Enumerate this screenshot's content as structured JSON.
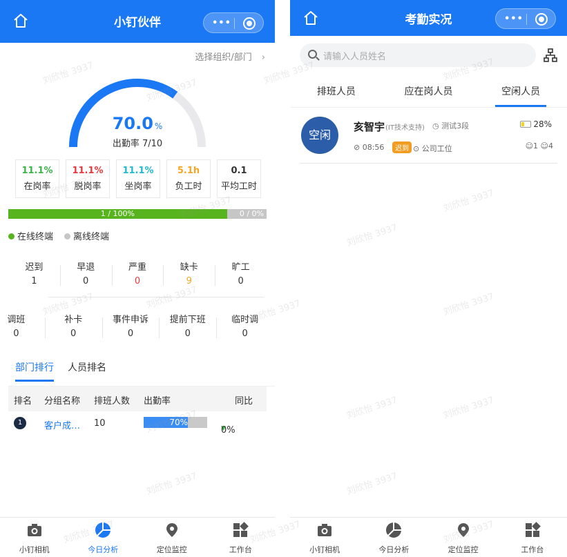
{
  "left": {
    "title": "小钉伙伴",
    "select_org": "选择组织/部门",
    "gauge": {
      "value": "70.0",
      "unit": "%",
      "label": "出勤率 7/10",
      "fraction": 0.7
    },
    "stats": [
      {
        "value": "11.1%",
        "label": "在岗率",
        "color": "#3bb54a"
      },
      {
        "value": "11.1%",
        "label": "脱岗率",
        "color": "#e8383d"
      },
      {
        "value": "11.1%",
        "label": "坐岗率",
        "color": "#1fbad1"
      },
      {
        "value": "5.1h",
        "label": "负工时",
        "color": "#f5a623"
      },
      {
        "value": "0.1",
        "label": "平均工时",
        "color": "#333333"
      }
    ],
    "terminal_bar": {
      "online_text": "1 / 100%",
      "offline_text": "0 / 0%",
      "online_fraction": 0.847
    },
    "legend": {
      "online": "在线终端",
      "offline": "离线终端"
    },
    "row1": [
      {
        "label": "迟到",
        "value": "1"
      },
      {
        "label": "早退",
        "value": "0"
      },
      {
        "label": "严重",
        "value": "0"
      },
      {
        "label": "缺卡",
        "value": "9"
      },
      {
        "label": "旷工",
        "value": "0"
      }
    ],
    "row2": [
      {
        "label": "调班",
        "value": "0"
      },
      {
        "label": "补卡",
        "value": "0"
      },
      {
        "label": "事件申诉",
        "value": "0"
      },
      {
        "label": "提前下班",
        "value": "0"
      },
      {
        "label": "临时调",
        "value": "0"
      }
    ],
    "tabs": {
      "dept_rank": "部门排行",
      "person_rank": "人员排名"
    },
    "table": {
      "headers": {
        "rank": "排名",
        "group": "分组名称",
        "scheduled": "排班人数",
        "attendance": "出勤率",
        "yoy": "同比"
      },
      "rows": [
        {
          "rank": "1",
          "group": "客户成…",
          "scheduled": "10",
          "attendance": "70%",
          "attendance_fraction": 0.7,
          "yoy": "0%"
        }
      ]
    }
  },
  "right": {
    "title": "考勤实况",
    "search_placeholder": "请输入人员姓名",
    "tabs": {
      "scheduled": "排班人员",
      "on_duty": "应在岗人员",
      "idle": "空闲人员"
    },
    "card": {
      "avatar": "空闲",
      "name": "亥智宇",
      "dept": "(IT技术支持)",
      "shift": "测试3段",
      "battery": "28%",
      "time": "08:56",
      "late_badge": "迟到",
      "location": "公司工位",
      "count_a": "1",
      "count_b": "4"
    }
  },
  "tabbar": {
    "camera": "小钉相机",
    "analysis": "今日分析",
    "location": "定位监控",
    "workbench": "工作台"
  },
  "watermark": "刘欣怡 3937",
  "colors": {
    "primary": "#1a78f5",
    "green": "#57b31e"
  }
}
